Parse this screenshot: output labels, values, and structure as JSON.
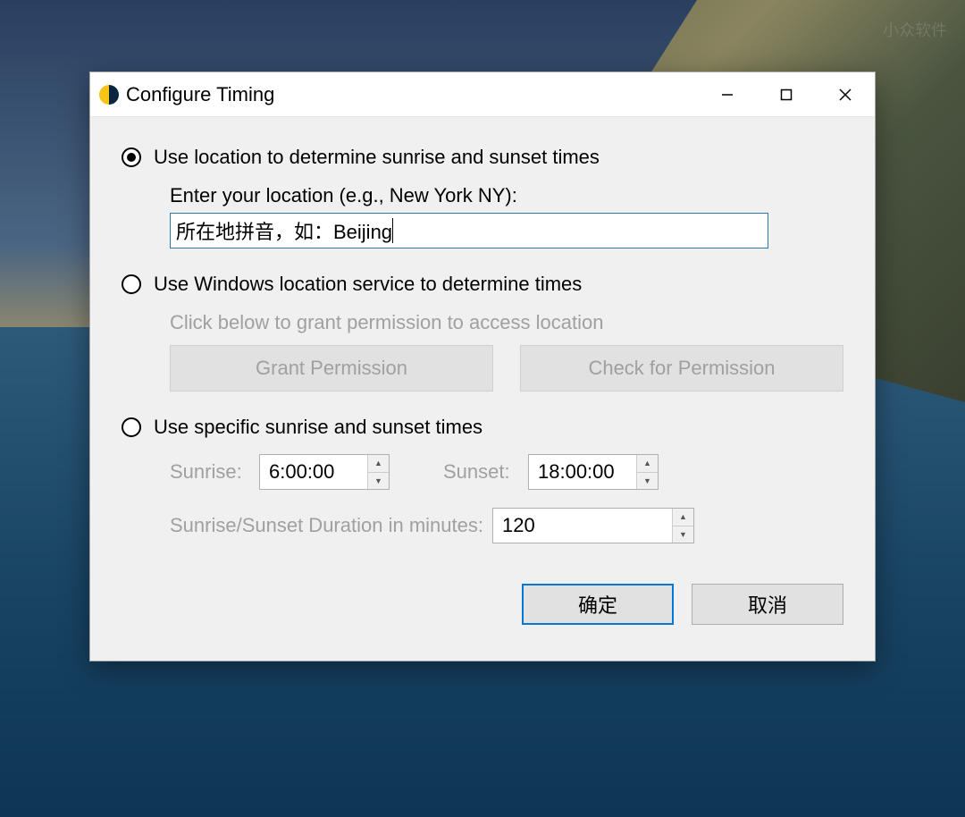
{
  "window": {
    "title": "Configure Timing"
  },
  "option1": {
    "label": "Use location to determine sunrise and sunset times",
    "sublabel": "Enter your location (e.g., New York NY):",
    "input_value": "所在地拼音，如：Beijing",
    "checked": true
  },
  "option2": {
    "label": "Use Windows location service to determine times",
    "sublabel": "Click below to grant permission to access location",
    "grant_button": "Grant Permission",
    "check_button": "Check for Permission",
    "checked": false
  },
  "option3": {
    "label": "Use specific sunrise and sunset times",
    "sunrise_label": "Sunrise:",
    "sunrise_value": "6:00:00",
    "sunset_label": "Sunset:",
    "sunset_value": "18:00:00",
    "duration_label": "Sunrise/Sunset Duration in minutes:",
    "duration_value": "120",
    "checked": false
  },
  "footer": {
    "ok": "确定",
    "cancel": "取消"
  },
  "watermark": "小众软件"
}
